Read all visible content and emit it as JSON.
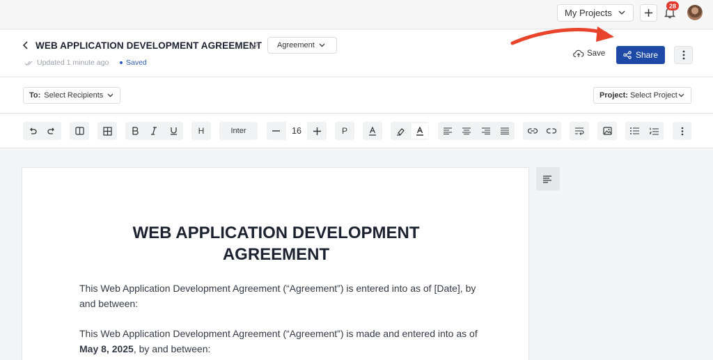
{
  "topbar": {
    "projects_label": "My Projects",
    "notification_count": "28",
    "icons": [
      "chevron-down-icon",
      "plus-icon",
      "bell-icon",
      "avatar"
    ]
  },
  "header": {
    "title": "WEB APPLICATION DEVELOPMENT AGREEMENT",
    "type_label": "Agreement",
    "updated_text": "Updated 1 minute ago",
    "saved_text": "Saved",
    "save_label": "Save",
    "share_label": "Share",
    "accent_color": "#1e49a6",
    "annotation_arrow_color": "#e8432b"
  },
  "recipients": {
    "to_label": "To:",
    "to_value": "Select Recipients",
    "project_label": "Project:",
    "project_value": "Select Project"
  },
  "toolbar": {
    "font_family": "Inter",
    "font_size": "16",
    "heading_label": "H",
    "paragraph_label": "P",
    "icons": [
      "undo-icon",
      "redo-icon",
      "column-icon",
      "table-icon",
      "bold-icon",
      "italic-icon",
      "underline-icon",
      "heading-icon",
      "decrease-icon",
      "increase-icon",
      "paragraph-icon",
      "text-color-icon",
      "highlight-icon",
      "font-color-icon",
      "align-left-icon",
      "align-center-icon",
      "align-right-icon",
      "align-justify-icon",
      "link-icon",
      "unlink-icon",
      "text-wrap-icon",
      "image-icon",
      "bullet-list-icon",
      "numbered-list-icon",
      "more-icon"
    ]
  },
  "document": {
    "heading": "WEB APPLICATION DEVELOPMENT AGREEMENT",
    "para1": "This Web Application Development Agreement (“Agreement”) is entered into as of [Date], by and between:",
    "para2_before": "This Web Application Development Agreement (“Agreement”) is made and entered into as of ",
    "para2_date": "May 8, 2025",
    "para2_after": ", by and between:"
  }
}
